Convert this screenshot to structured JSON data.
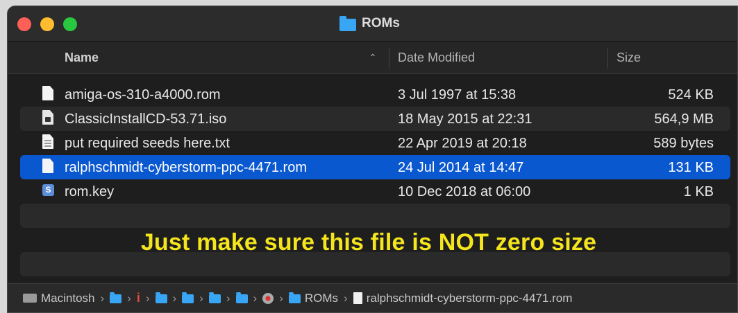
{
  "window": {
    "title": "ROMs",
    "folder_icon": "folder-icon"
  },
  "columns": {
    "name": "Name",
    "sort": "^",
    "date": "Date Modified",
    "size": "Size"
  },
  "files": [
    {
      "name": "amiga-os-310-a4000.rom",
      "date": "3 Jul 1997 at 15:38",
      "size": "524 KB",
      "icon": "document-icon"
    },
    {
      "name": "ClassicInstallCD-53.71.iso",
      "date": "18 May 2015 at 22:31",
      "size": "564,9 MB",
      "icon": "disk-image-icon"
    },
    {
      "name": "put required seeds here.txt",
      "date": "22 Apr 2019 at 20:18",
      "size": "589 bytes",
      "icon": "text-document-icon"
    },
    {
      "name": "ralphschmidt-cyberstorm-ppc-4471.rom",
      "date": "24 Jul 2014 at 14:47",
      "size": "131 KB",
      "icon": "document-icon",
      "selected": true
    },
    {
      "name": "rom.key",
      "date": "10 Dec 2018 at 06:00",
      "size": "1 KB",
      "icon": "key-file-icon"
    }
  ],
  "annotation": "Just make sure this file is NOT zero size",
  "pathbar": {
    "drive": "Macintosh",
    "folder": "ROMs",
    "file": "ralphschmidt-cyberstorm-ppc-4471.rom",
    "sep": "›"
  },
  "colors": {
    "selection": "#0a58d0",
    "annotation": "#f5e51c",
    "folder": "#38a6f5"
  }
}
